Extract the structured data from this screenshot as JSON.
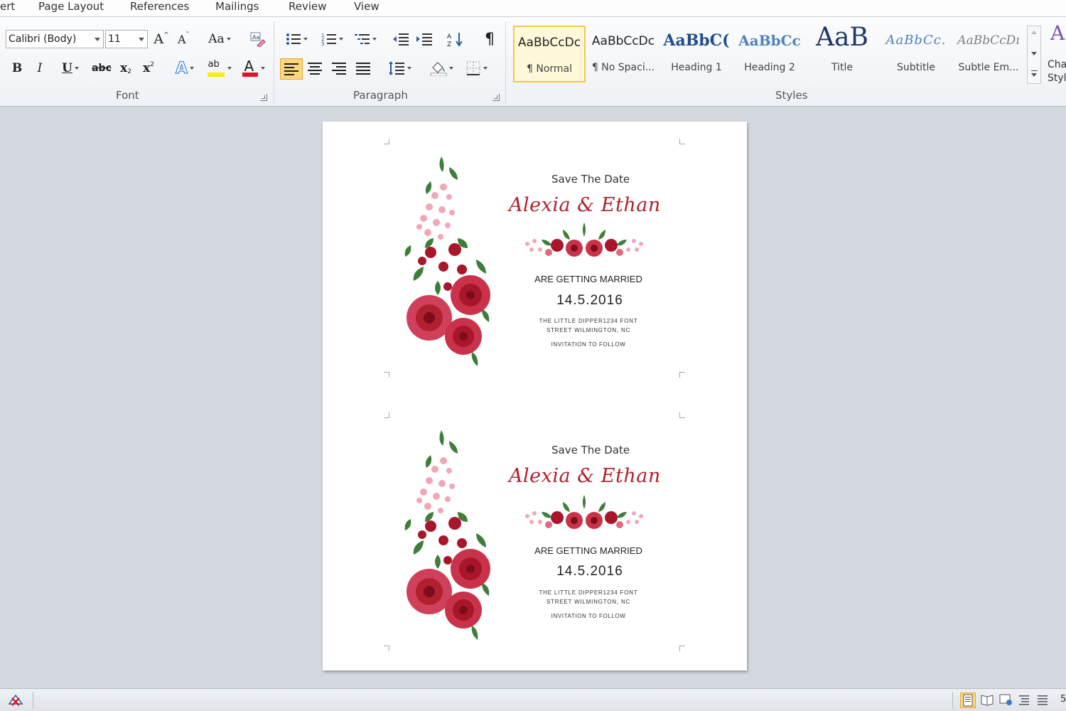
{
  "tabs": [
    {
      "label": "ert"
    },
    {
      "label": "Page Layout"
    },
    {
      "label": "References"
    },
    {
      "label": "Mailings"
    },
    {
      "label": "Review"
    },
    {
      "label": "View"
    }
  ],
  "font_group": {
    "label": "Font",
    "font_name": "Calibri (Body)",
    "font_size": "11",
    "change_case": "Aa",
    "bold": "B",
    "italic": "I",
    "underline": "U",
    "strikethrough": "abc",
    "subscript": "x",
    "superscript": "x",
    "text_effects": "A",
    "highlight": "ab",
    "font_color": "A",
    "grow": "A",
    "shrink": "A"
  },
  "paragraph_group": {
    "label": "Paragraph",
    "sort": "A↓",
    "pilcrow": "¶"
  },
  "styles_group": {
    "label": "Styles",
    "items": [
      {
        "sample": "AaBbCcDc",
        "name": "¶ Normal",
        "selected": true
      },
      {
        "sample": "AaBbCcDc",
        "name": "¶ No Spaci..."
      },
      {
        "sample": "AaBbC(",
        "name": "Heading 1"
      },
      {
        "sample": "AaBbCc",
        "name": "Heading 2"
      },
      {
        "sample": "AaB",
        "name": "Title"
      },
      {
        "sample": "AaBbCc.",
        "name": "Subtitle"
      },
      {
        "sample": "AaBbCcDı",
        "name": "Subtle Em..."
      }
    ],
    "change_styles": "Cha Styl"
  },
  "document": {
    "cards": [
      {
        "save_the_date": "Save The Date",
        "names": "Alexia & Ethan",
        "getting_married": "ARE GETTING MARRIED",
        "date": "14.5.2016",
        "address_line1": "THE LITTLE DIPPER1234 FONT",
        "address_line2": "STREET WILMINGTON, NC",
        "invitation": "INVITATION TO FOLLOW"
      },
      {
        "save_the_date": "Save The Date",
        "names": "Alexia & Ethan",
        "getting_married": "ARE GETTING MARRIED",
        "date": "14.5.2016",
        "address_line1": "THE LITTLE DIPPER1234 FONT",
        "address_line2": "STREET WILMINGTON, NC",
        "invitation": "INVITATION TO FOLLOW"
      }
    ]
  },
  "statusbar": {
    "zoom_partial": "5"
  },
  "colors": {
    "accent_red": "#b0202e",
    "rose": "#c9324a",
    "leaf": "#3f7d3a",
    "selected_style_border": "#f1c94a"
  }
}
